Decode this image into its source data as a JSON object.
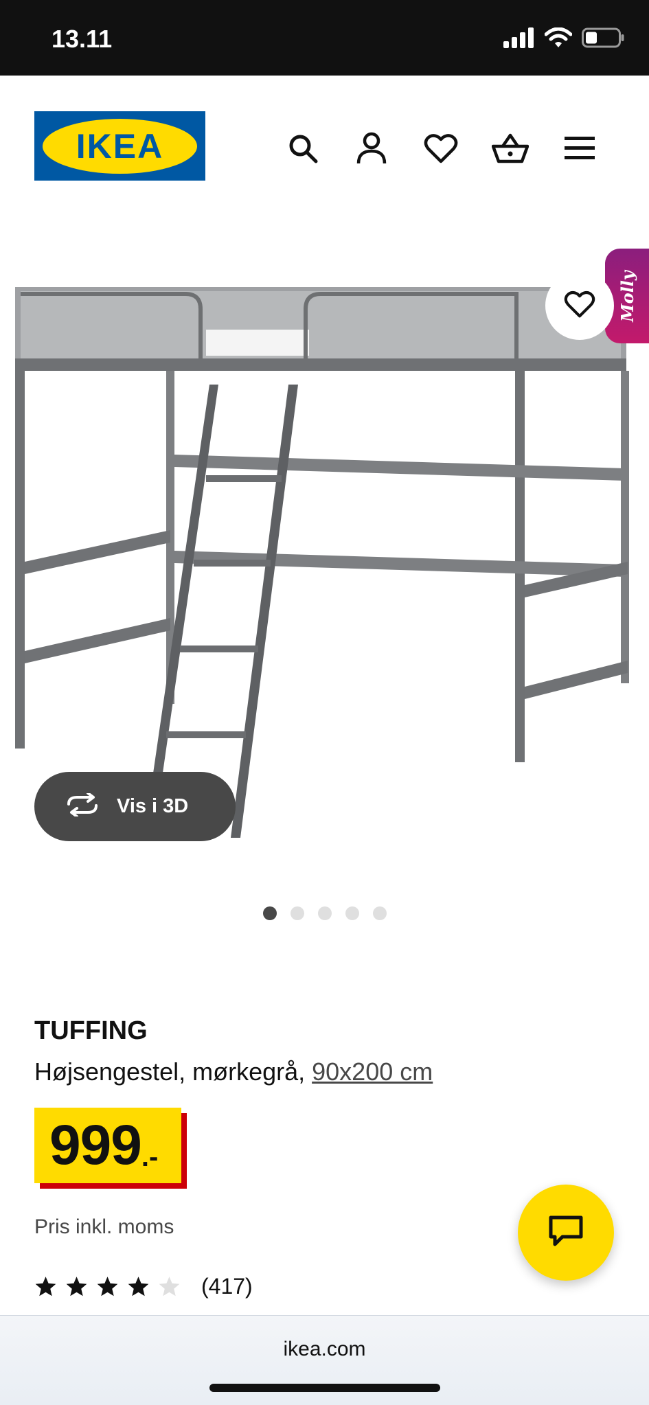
{
  "status_bar": {
    "time": "13.11"
  },
  "header": {
    "logo_text": "IKEA",
    "icons": [
      "search-icon",
      "user-icon",
      "heart-icon",
      "basket-icon",
      "menu-icon"
    ]
  },
  "gallery": {
    "badge_label": "Molly",
    "view_3d_label": "Vis i 3D",
    "image_count": 5,
    "active_index": 0
  },
  "product": {
    "name": "TUFFING",
    "description": "Højsengestel, mørkegrå, ",
    "size_link": "90x200 cm",
    "price_value": "999",
    "price_suffix": ".-",
    "price_note": "Pris inkl. moms",
    "rating": 4,
    "rating_max": 5,
    "review_count": "(417)"
  },
  "browser": {
    "url": "ikea.com"
  },
  "colors": {
    "brand_blue": "#0058a3",
    "brand_yellow": "#ffdb00",
    "price_red": "#cc0008",
    "badge_purple": "#8b1e7d"
  }
}
